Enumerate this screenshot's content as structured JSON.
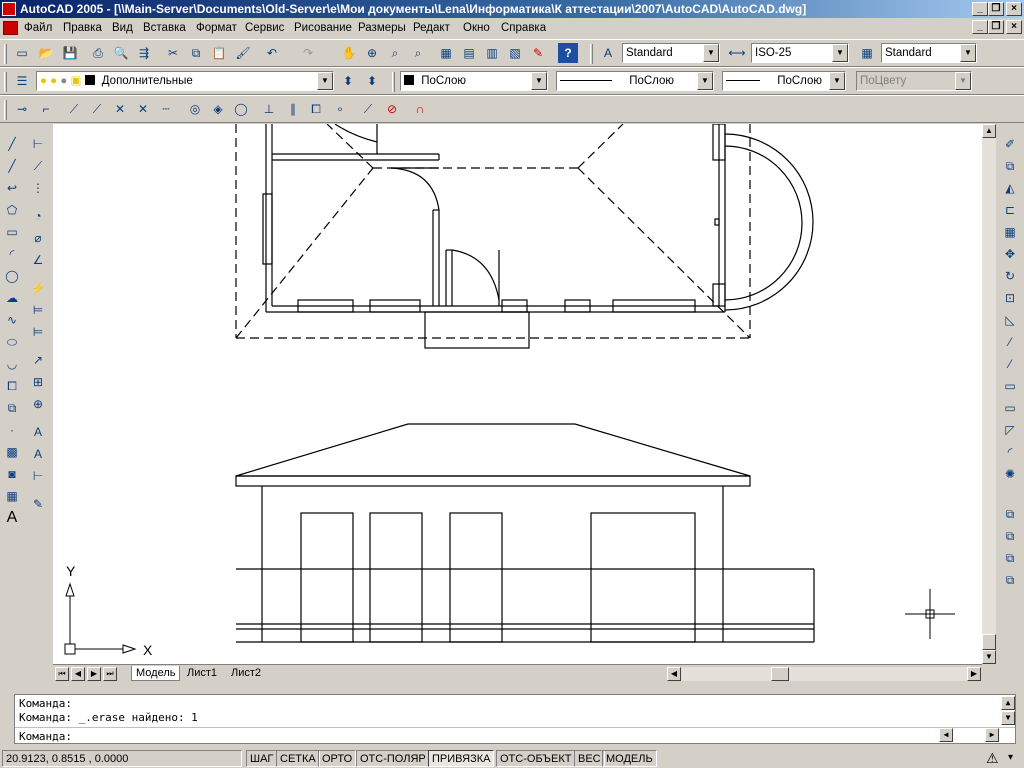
{
  "window": {
    "title": "AutoCAD 2005 - [\\\\Main-Server\\Documents\\Old-Server\\e\\Мои документы\\Lena\\Информатика\\К аттестации\\2007\\AutoCAD\\AutoCAD.dwg]"
  },
  "menu": {
    "items": [
      "Файл",
      "Правка",
      "Вид",
      "Вставка",
      "Формат",
      "Сервис",
      "Рисование",
      "Размеры",
      "Редакт",
      "Окно",
      "Справка"
    ]
  },
  "styles_toolbar": {
    "text_style": "Standard",
    "dim_style": "ISO-25",
    "table_style": "Standard"
  },
  "layers_toolbar": {
    "layer": "Дополнительные"
  },
  "properties_toolbar": {
    "color": "ПоСлою",
    "linetype": "ПоСлою",
    "lineweight": "ПоСлою",
    "plotstyle": "ПоЦвету"
  },
  "ucs_icon": {
    "x_label": "X",
    "y_label": "Y"
  },
  "tabs": [
    "Модель",
    "Лист1",
    "Лист2"
  ],
  "command": {
    "lines": [
      "Команда:",
      "Команда: _.erase найдено: 1"
    ],
    "prompt": "Команда:"
  },
  "status": {
    "coords": "20.9123, 0.8515 , 0.0000",
    "buttons": [
      {
        "label": "ШАГ",
        "on": false
      },
      {
        "label": "СЕТКА",
        "on": false
      },
      {
        "label": "ОРТО",
        "on": false
      },
      {
        "label": "ОТС-ПОЛЯР",
        "on": false
      },
      {
        "label": "ПРИВЯЗКА",
        "on": true
      },
      {
        "label": "ОТС-ОБЪЕКТ",
        "on": false
      },
      {
        "label": "ВЕС",
        "on": false
      },
      {
        "label": "МОДЕЛЬ",
        "on": false
      }
    ]
  },
  "colors": {
    "titlebar": "#0a246a",
    "face": "#d4d0c8",
    "canvas": "#ffffff"
  }
}
